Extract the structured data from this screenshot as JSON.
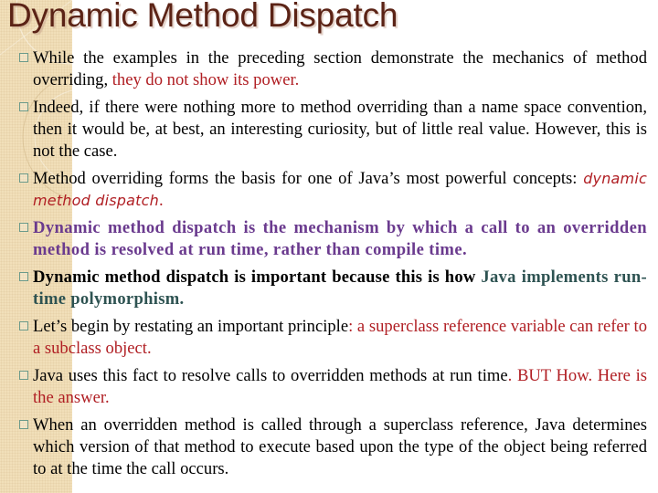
{
  "slide": {
    "title": "Dynamic Method Dispatch",
    "bullet_icon": "square-bullet-icon",
    "colors": {
      "title": "#5b2316",
      "emphasis_red": "#b01e23",
      "emphasis_purple": "#6a3a8e",
      "emphasis_teal": "#2e5352",
      "side_panel": "#f1dfb9",
      "bullet_border": "#6b9a8a"
    },
    "items": [
      {
        "parts": [
          {
            "text": "While the examples in the preceding section demonstrate the mechanics of method overriding, ",
            "style": "normal"
          },
          {
            "text": "they do not show its power.",
            "style": "red"
          }
        ]
      },
      {
        "parts": [
          {
            "text": "Indeed, if there were nothing more to method overriding than a name space convention, then it would be, at best, an interesting curiosity, but of little real value. However, this is not the case.",
            "style": "normal"
          }
        ]
      },
      {
        "parts": [
          {
            "text": "Method overriding forms the basis for one of Java’s most powerful concepts: ",
            "style": "normal"
          },
          {
            "text": "dynamic method dispatch",
            "style": "red-italic"
          },
          {
            "text": ".",
            "style": "red"
          }
        ]
      },
      {
        "parts": [
          {
            "text": "Dynamic method dispatch is the mechanism by which a call to an overridden method is resolved at run time, rather than compile time.",
            "style": "purple-bold"
          }
        ]
      },
      {
        "parts": [
          {
            "text": "Dynamic method dispatch is important because this is how ",
            "style": "black-bold"
          },
          {
            "text": "Java implements run-time polymorphism.",
            "style": "teal-bold"
          }
        ]
      },
      {
        "parts": [
          {
            "text": "Let’s begin by restating an important principle",
            "style": "normal"
          },
          {
            "text": ": a superclass reference variable can refer to a subclass object.",
            "style": "red"
          }
        ]
      },
      {
        "parts": [
          {
            "text": "Java uses this fact to resolve calls to overridden methods at run time",
            "style": "normal"
          },
          {
            "text": ". BUT How. Here is the answer.",
            "style": "red"
          }
        ]
      },
      {
        "parts": [
          {
            "text": "When an overridden method is called through a superclass reference, Java determines which version of that method to execute based upon the type of the object being referred to at the time the call occurs.",
            "style": "normal"
          }
        ]
      }
    ]
  }
}
